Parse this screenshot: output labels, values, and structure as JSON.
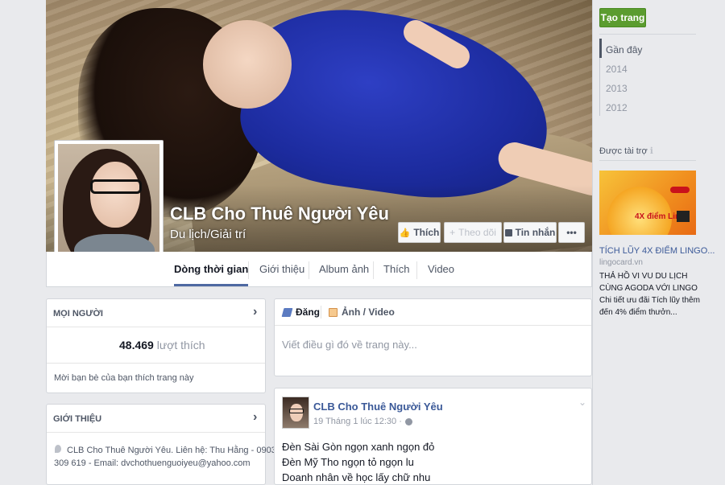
{
  "page": {
    "name": "CLB Cho Thuê Người Yêu",
    "category": "Du lịch/Giải trí"
  },
  "cover_buttons": {
    "like": "Thích",
    "follow": "Theo dõi",
    "message": "Tin nhắn",
    "more": "•••"
  },
  "tabs": [
    {
      "label": "Dòng thời gian",
      "active": true
    },
    {
      "label": "Giới thiệu"
    },
    {
      "label": "Album ảnh"
    },
    {
      "label": "Thích"
    },
    {
      "label": "Video"
    }
  ],
  "people": {
    "title": "MỌI NGƯỜI",
    "likes_count": "48.469",
    "likes_label": "lượt thích",
    "invite": "Mời bạn bè của bạn thích trang này"
  },
  "about": {
    "title": "GIỚI THIỆU",
    "text_line1": "CLB Cho Thuê Người Yêu. Liên hệ: Thu Hằng - 0903",
    "text_line2": "309 619 - Email: dvchothuenguoiyeu@yahoo.com"
  },
  "composer": {
    "post_tab": "Đăng",
    "photo_tab": "Ảnh / Video",
    "placeholder": "Viết điều gì đó về trang này..."
  },
  "post": {
    "author": "CLB Cho Thuê Người Yêu",
    "time": "19 Tháng 1 lúc 12:30 ·",
    "lines": [
      "Đèn Sài Gòn ngọn xanh ngọn đỏ",
      "Đèn Mỹ Tho ngọn tỏ ngọn lu",
      "Doanh nhân về học lấy chữ nhu"
    ]
  },
  "right": {
    "create_page": "Tạo trang",
    "years": [
      {
        "label": "Gần đây",
        "active": true
      },
      {
        "label": "2014"
      },
      {
        "label": "2013"
      },
      {
        "label": "2012"
      }
    ],
    "sponsored": "Được tài trợ",
    "ad": {
      "image_text": "4X điểm Lingo",
      "title": "TÍCH LŨY 4X ĐIỂM LINGO...",
      "domain": "lingocard.vn",
      "body_line1": "THẢ HỒ VI VU DU LỊCH",
      "body_line2": "CÙNG AGODA VỚI LINGO",
      "body_line3": "Chi tiết ưu đãi Tích lũy thêm",
      "body_line4": "đến 4% điểm thưởn..."
    }
  }
}
